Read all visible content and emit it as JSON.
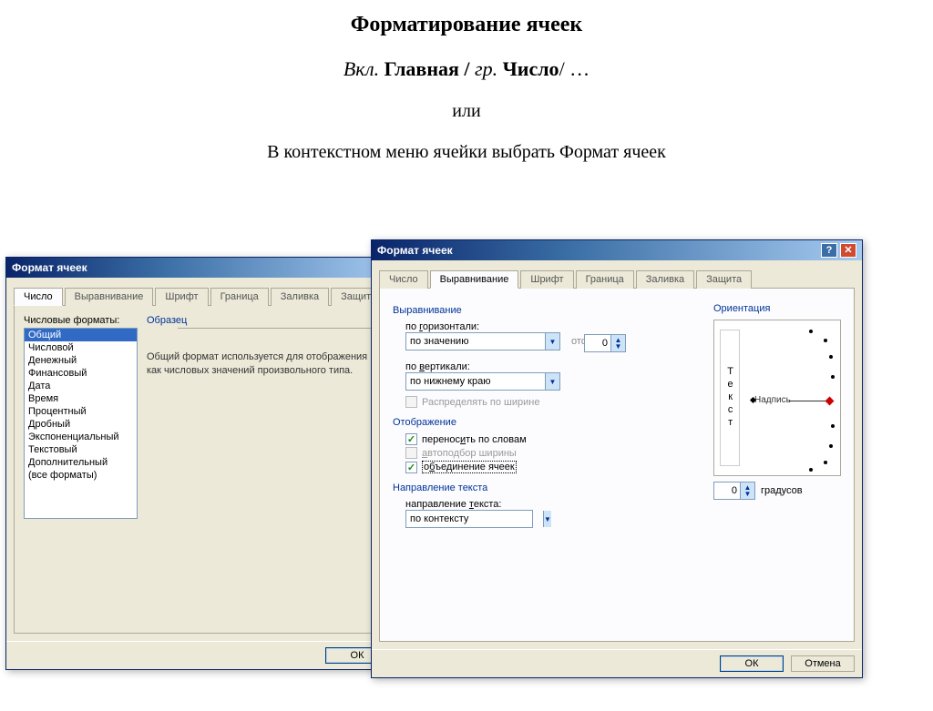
{
  "slide": {
    "title": "Форматирование ячеек",
    "subtitle_prefix": "Вкл. ",
    "subtitle_mid1": "Главная",
    "subtitle_sep1": " / ",
    "subtitle_prefix2": "гр.",
    "subtitle_mid2": "  Число",
    "subtitle_suffix": "/ …",
    "or": "или",
    "context": "В контекстном меню ячейки выбрать ",
    "context_bold": "Формат ячеек"
  },
  "dialog1": {
    "title": "Формат ячеек",
    "tabs": [
      "Число",
      "Выравнивание",
      "Шрифт",
      "Граница",
      "Заливка",
      "Защита"
    ],
    "active_tab": "Число",
    "formats_label": "Числовые форматы:",
    "formats": [
      "Общий",
      "Числовой",
      "Денежный",
      "Финансовый",
      "Дата",
      "Время",
      "Процентный",
      "Дробный",
      "Экспоненциальный",
      "Текстовый",
      "Дополнительный",
      "(все форматы)"
    ],
    "selected_format": "Общий",
    "sample_label": "Образец",
    "description": "Общий формат используется для отображения как числовых значений произвольного типа.",
    "ok": "ОК"
  },
  "dialog2": {
    "title": "Формат ячеек",
    "tabs": [
      "Число",
      "Выравнивание",
      "Шрифт",
      "Граница",
      "Заливка",
      "Защита"
    ],
    "active_tab": "Выравнивание",
    "group_align": "Выравнивание",
    "h_label": "по горизонтали:",
    "h_value": "по значению",
    "indent_label": "отступ:",
    "indent_value": "0",
    "v_label": "по вертикали:",
    "v_value": "по нижнему краю",
    "distribute": "Распределять по ширине",
    "group_display": "Отображение",
    "wrap": "переносить по словам",
    "autofit": "автоподбор ширины",
    "merge": "объединение ячеек",
    "group_dir": "Направление текста",
    "dir_label": "направление текста:",
    "dir_value": "по контексту",
    "orientation_label": "Ориентация",
    "vert_text": "Текст",
    "dial_label": "Надпись",
    "degrees_value": "0",
    "degrees_unit": "градусов",
    "ok": "ОК",
    "cancel": "Отмена"
  }
}
